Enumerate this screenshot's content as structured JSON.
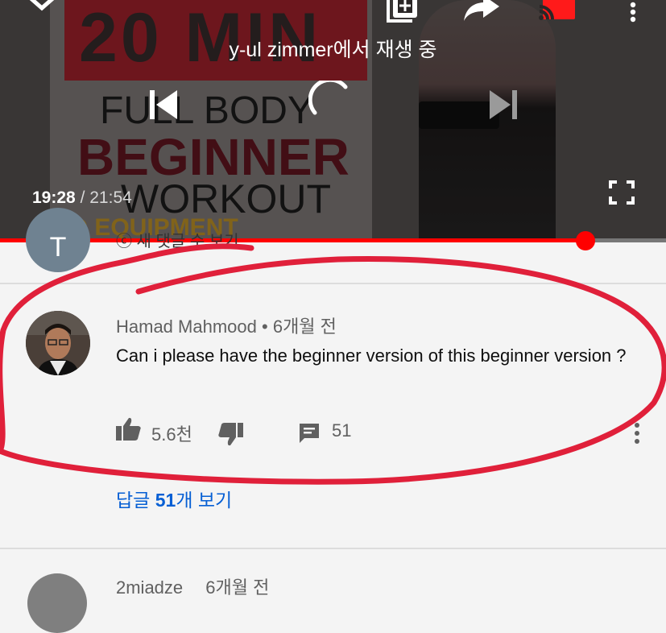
{
  "player": {
    "thumbnail_text": {
      "line1": "20 MIN",
      "line2": "FULL BODY",
      "line3": "BEGINNER",
      "line4": "WORKOUT",
      "line5": "NO EQUIPMENT"
    },
    "playing_on": "y-ul zimmer에서 재생 중",
    "time_current": "19:28",
    "time_separator": "/",
    "time_duration": "21:54",
    "progress_fraction": 0.879,
    "accent_color": "#ff0000",
    "icons": [
      "chevron-down-icon",
      "add-to-queue-icon",
      "share-icon",
      "cast-icon",
      "more-vert-icon",
      "previous-icon",
      "loading-spinner-icon",
      "next-icon",
      "fullscreen-icon"
    ]
  },
  "previous_comment": {
    "avatar_letter": "T",
    "text": "ⓒ 새 댓글 수 보기"
  },
  "comment": {
    "author": "Hamad Mahmood",
    "dot": "•",
    "age": "6개월 전",
    "text": "Can i please have the beginner version of this beginner version ?",
    "likes": "5.6천",
    "replies_count": "51",
    "view_replies_prefix": "답글 ",
    "view_replies_count": "51",
    "view_replies_suffix": "개 보기"
  },
  "next_comment": {
    "author": "2miadze",
    "age": "6개월 전"
  },
  "annotation_color": "#e0203a"
}
